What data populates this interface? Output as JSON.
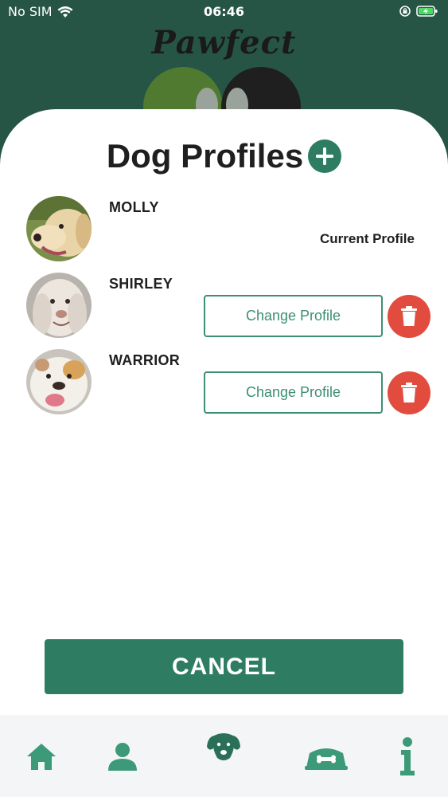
{
  "status_bar": {
    "carrier": "No SIM",
    "time": "06:46"
  },
  "app": {
    "logo_text": "Pawfect"
  },
  "header": {
    "title": "Dog Profiles",
    "add_icon": "plus-circle-icon"
  },
  "dogs": [
    {
      "name": "MOLLY",
      "status": "Current Profile",
      "is_current": true,
      "avatar": "dog-photo-labrador"
    },
    {
      "name": "SHIRLEY",
      "action_label": "Change Profile",
      "is_current": false,
      "avatar": "dog-photo-white-fluffy"
    },
    {
      "name": "WARRIOR",
      "action_label": "Change Profile",
      "is_current": false,
      "avatar": "dog-photo-bulldog"
    }
  ],
  "footer": {
    "cancel_label": "CANCEL"
  },
  "tabbar": {
    "items": [
      {
        "icon": "home-icon"
      },
      {
        "icon": "user-icon"
      },
      {
        "icon": "dog-head-icon"
      },
      {
        "icon": "dog-bowl-icon"
      },
      {
        "icon": "info-icon"
      }
    ]
  },
  "colors": {
    "primary": "#2e7d62",
    "danger": "#e24c3e",
    "header_bg": "#265546"
  }
}
